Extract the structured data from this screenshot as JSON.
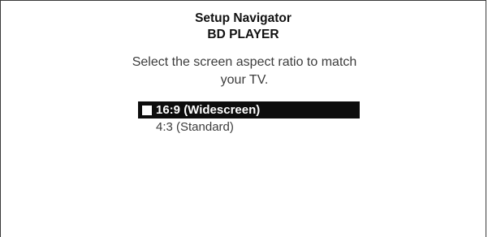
{
  "header": {
    "title": "Setup Navigator",
    "subtitle": "BD PLAYER"
  },
  "prompt": {
    "line1": "Select the screen aspect ratio to match",
    "line2": "your TV."
  },
  "options": [
    {
      "label": "16:9 (Widescreen)",
      "selected": true
    },
    {
      "label": "4:3 (Standard)",
      "selected": false
    }
  ],
  "colors": {
    "highlight_bg": "#0d0d0d",
    "highlight_text": "#ffffff",
    "text": "#3c3c3c",
    "background": "#ffffff",
    "border": "#3a3a3a"
  }
}
